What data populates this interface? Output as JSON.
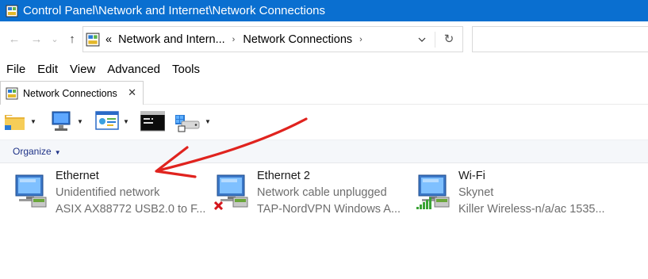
{
  "window": {
    "title": "Control Panel\\Network and Internet\\Network Connections"
  },
  "address": {
    "overflow": "«",
    "crumbs": [
      "Network and Intern...",
      "Network Connections"
    ],
    "separator": "›",
    "refresh": "↻"
  },
  "nav": {
    "back": "←",
    "forward": "→",
    "recent": "⌄",
    "up": "↑"
  },
  "menu": [
    "File",
    "Edit",
    "View",
    "Advanced",
    "Tools"
  ],
  "tab": {
    "label": "Network Connections",
    "close": "✕"
  },
  "toolbar": {
    "dropdown_glyph": "▼",
    "buttons": [
      "folder-icon",
      "computer-icon",
      "control-panel-icon",
      "command-prompt-icon",
      "network-drive-icon"
    ]
  },
  "command_bar": {
    "organize_label": "Organize",
    "organize_caret": "▼"
  },
  "connections": [
    {
      "name": "Ethernet",
      "status": "Unidentified network",
      "device": "ASIX AX88772 USB2.0 to F...",
      "badge": "none"
    },
    {
      "name": "Ethernet 2",
      "status": "Network cable unplugged",
      "device": "TAP-NordVPN Windows A...",
      "badge": "red-x"
    },
    {
      "name": "Wi-Fi",
      "status": "Skynet",
      "device": "Killer Wireless-n/a/ac 1535...",
      "badge": "signal-bars"
    }
  ],
  "colors": {
    "titlebar": "#0a6fd0",
    "annotation_arrow": "#e0231e",
    "link_blue": "#1e3287",
    "secondary_text": "#6d6d6d"
  }
}
